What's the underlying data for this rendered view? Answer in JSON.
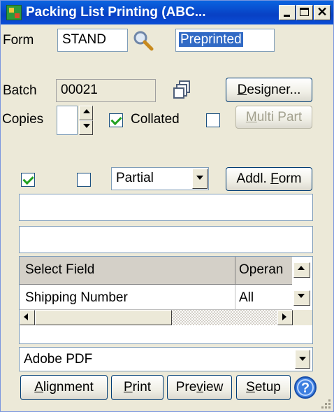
{
  "window": {
    "title": "Packing List Printing (ABC..."
  },
  "form": {
    "label": "Form",
    "value": "STAND",
    "type_value": "Preprinted"
  },
  "batch": {
    "label": "Batch",
    "value": "00021"
  },
  "copies": {
    "label": "Copies",
    "value": "",
    "collated_label": "Collated",
    "collated": true,
    "multipart_checked": false
  },
  "buttons": {
    "designer": {
      "pre": "",
      "key": "D",
      "post": "esigner..."
    },
    "multipart": {
      "pre": "",
      "key": "M",
      "post": "ulti Part"
    },
    "addl_form": {
      "pre": "Addl. ",
      "key": "F",
      "post": "orm"
    },
    "alignment": {
      "pre": "",
      "key": "A",
      "post": "lignment"
    },
    "print": {
      "pre": "",
      "key": "P",
      "post": "rint"
    },
    "preview": {
      "pre": "Pre",
      "key": "v",
      "post": "iew"
    },
    "setup": {
      "pre": "",
      "key": "S",
      "post": "etup"
    }
  },
  "options": {
    "check1": true,
    "check2": false,
    "mode": "Partial"
  },
  "message_lines": [
    "",
    ""
  ],
  "grid": {
    "columns": [
      "Select Field",
      "Operan"
    ],
    "rows": [
      {
        "field": "Shipping Number",
        "operand": "All"
      }
    ]
  },
  "printer": {
    "selected": "Adobe PDF"
  },
  "icons": [
    "app-icon",
    "search-icon",
    "copy-batch-icon",
    "help-icon",
    "size-grip-icon"
  ],
  "colors": {
    "title_bar": "#0a4ed6",
    "window_bg": "#ece9d8",
    "selection": "#316ac5",
    "check": "#21a121"
  }
}
